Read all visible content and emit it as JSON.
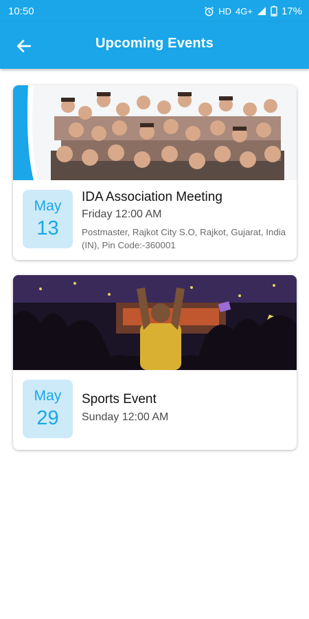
{
  "status_bar": {
    "time": "10:50",
    "network": "HD",
    "signal_type": "4G+",
    "battery_percent": "17%",
    "icons": [
      "alarm-icon",
      "signal-icon",
      "battery-icon"
    ]
  },
  "app_bar": {
    "title": "Upcoming Events",
    "back_icon": "arrow-left-icon",
    "color": "#1aa6e8"
  },
  "events": [
    {
      "image": "crowd-of-people-photo",
      "month": "May",
      "day": "13",
      "title": "IDA Association Meeting",
      "time": "Friday 12:00 AM",
      "address": "Postmaster, Rajkot City S.O, Rajkot, Gujarat, India (IN), Pin Code:-360001"
    },
    {
      "image": "stadium-crowd-photo",
      "month": "May",
      "day": "29",
      "title": "Sports Event",
      "time": "Sunday 12:00 AM",
      "address": ""
    }
  ],
  "colors": {
    "accent": "#1aa6e8",
    "date_badge_bg": "#cdeaf9"
  }
}
